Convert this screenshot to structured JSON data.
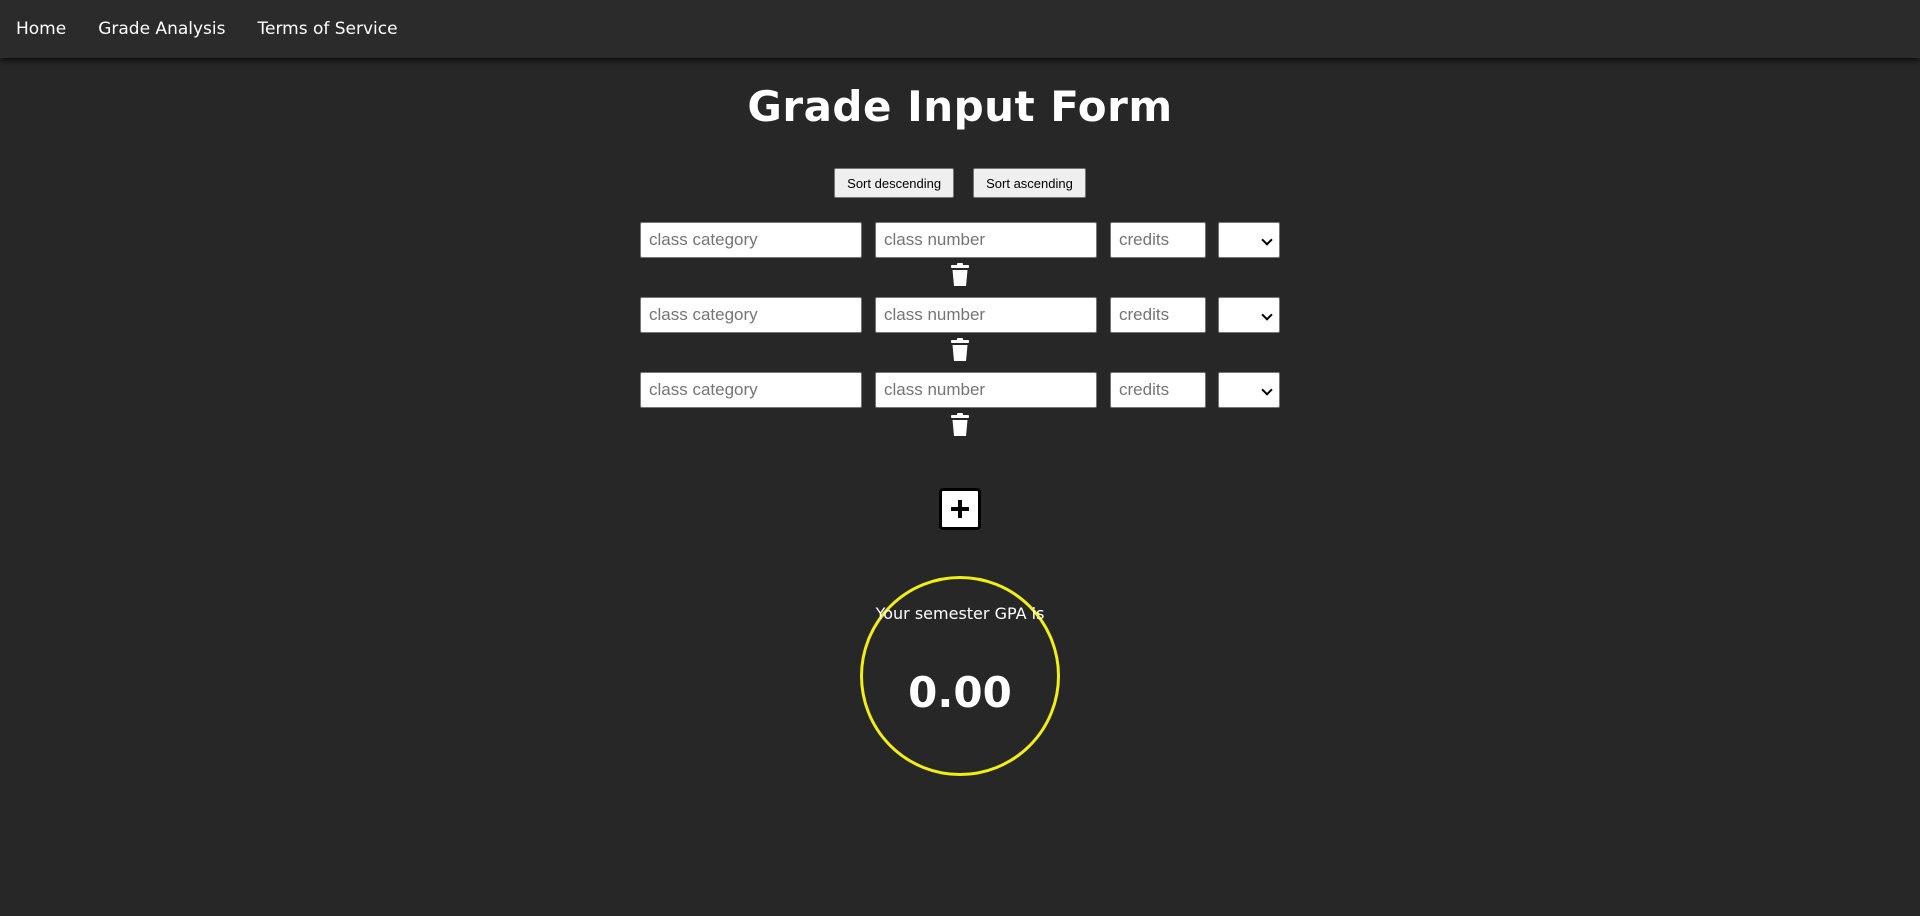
{
  "nav": {
    "links": [
      "Home",
      "Grade Analysis",
      "Terms of Service"
    ]
  },
  "page": {
    "title": "Grade Input Form"
  },
  "sort": {
    "descending_label": "Sort descending",
    "ascending_label": "Sort ascending"
  },
  "rows": [
    {
      "category_placeholder": "class category",
      "number_placeholder": "class number",
      "credits_placeholder": "credits",
      "grade": ""
    },
    {
      "category_placeholder": "class category",
      "number_placeholder": "class number",
      "credits_placeholder": "credits",
      "grade": ""
    },
    {
      "category_placeholder": "class category",
      "number_placeholder": "class number",
      "credits_placeholder": "credits",
      "grade": ""
    }
  ],
  "gpa": {
    "label": "Your semester GPA is",
    "value": "0.00",
    "ring_color": "#f0f012"
  },
  "icons": {
    "delete": "trash-icon",
    "add": "plus-icon",
    "dropdown": "chevron-down-icon"
  },
  "colors": {
    "background": "#272727",
    "navbar": "#2b2b2b"
  }
}
